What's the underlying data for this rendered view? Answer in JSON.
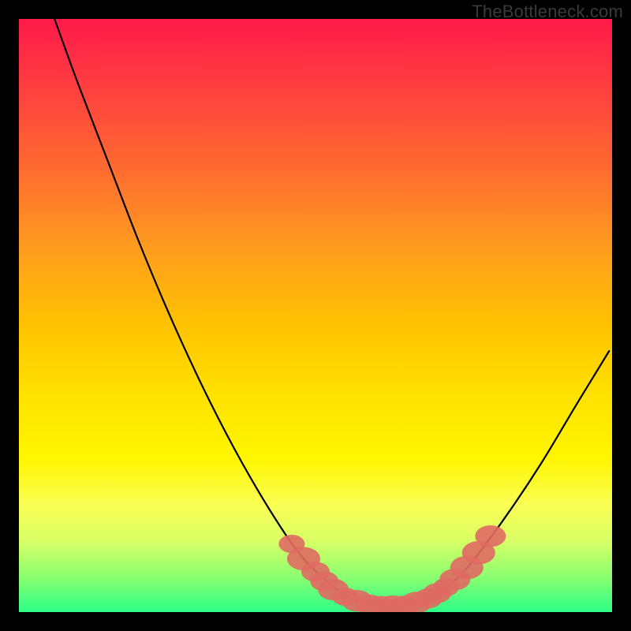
{
  "watermark": "TheBottleneck.com",
  "chart_data": {
    "type": "line",
    "title": "",
    "xlabel": "",
    "ylabel": "",
    "xlim": [
      0,
      100
    ],
    "ylim": [
      0,
      100
    ],
    "series": [
      {
        "name": "curve",
        "color": "#000000",
        "x": [
          6,
          10,
          15,
          20,
          25,
          30,
          35,
          40,
          45,
          48,
          51,
          54,
          57,
          60,
          63,
          66,
          69,
          72,
          76,
          82,
          88,
          94,
          99.5
        ],
        "y": [
          100,
          89,
          76,
          63,
          51,
          40,
          30,
          21,
          13,
          9,
          6,
          3.5,
          2,
          1.2,
          1,
          1.2,
          2.2,
          4,
          8,
          16,
          25,
          35,
          44
        ]
      }
    ],
    "markers": {
      "name": "highlight",
      "color": "#e06a63",
      "points": [
        {
          "x": 46,
          "y": 11.5,
          "r": 2.2
        },
        {
          "x": 48,
          "y": 9,
          "r": 2.8
        },
        {
          "x": 50,
          "y": 6.8,
          "r": 2.4
        },
        {
          "x": 51.5,
          "y": 5.2,
          "r": 2.4
        },
        {
          "x": 53,
          "y": 3.8,
          "r": 2.6
        },
        {
          "x": 55,
          "y": 2.6,
          "r": 2.2
        },
        {
          "x": 57,
          "y": 1.9,
          "r": 2.6
        },
        {
          "x": 59,
          "y": 1.3,
          "r": 2.4
        },
        {
          "x": 61,
          "y": 1.05,
          "r": 2.4
        },
        {
          "x": 63,
          "y": 1.0,
          "r": 2.6
        },
        {
          "x": 65,
          "y": 1.1,
          "r": 2.4
        },
        {
          "x": 67,
          "y": 1.6,
          "r": 2.6
        },
        {
          "x": 69,
          "y": 2.3,
          "r": 2.4
        },
        {
          "x": 70.5,
          "y": 3.2,
          "r": 2.4
        },
        {
          "x": 72,
          "y": 4.2,
          "r": 2.2
        },
        {
          "x": 73.5,
          "y": 5.5,
          "r": 2.6
        },
        {
          "x": 75.5,
          "y": 7.5,
          "r": 2.8
        },
        {
          "x": 77.5,
          "y": 10,
          "r": 2.8
        },
        {
          "x": 79.5,
          "y": 12.8,
          "r": 2.6
        }
      ]
    }
  }
}
